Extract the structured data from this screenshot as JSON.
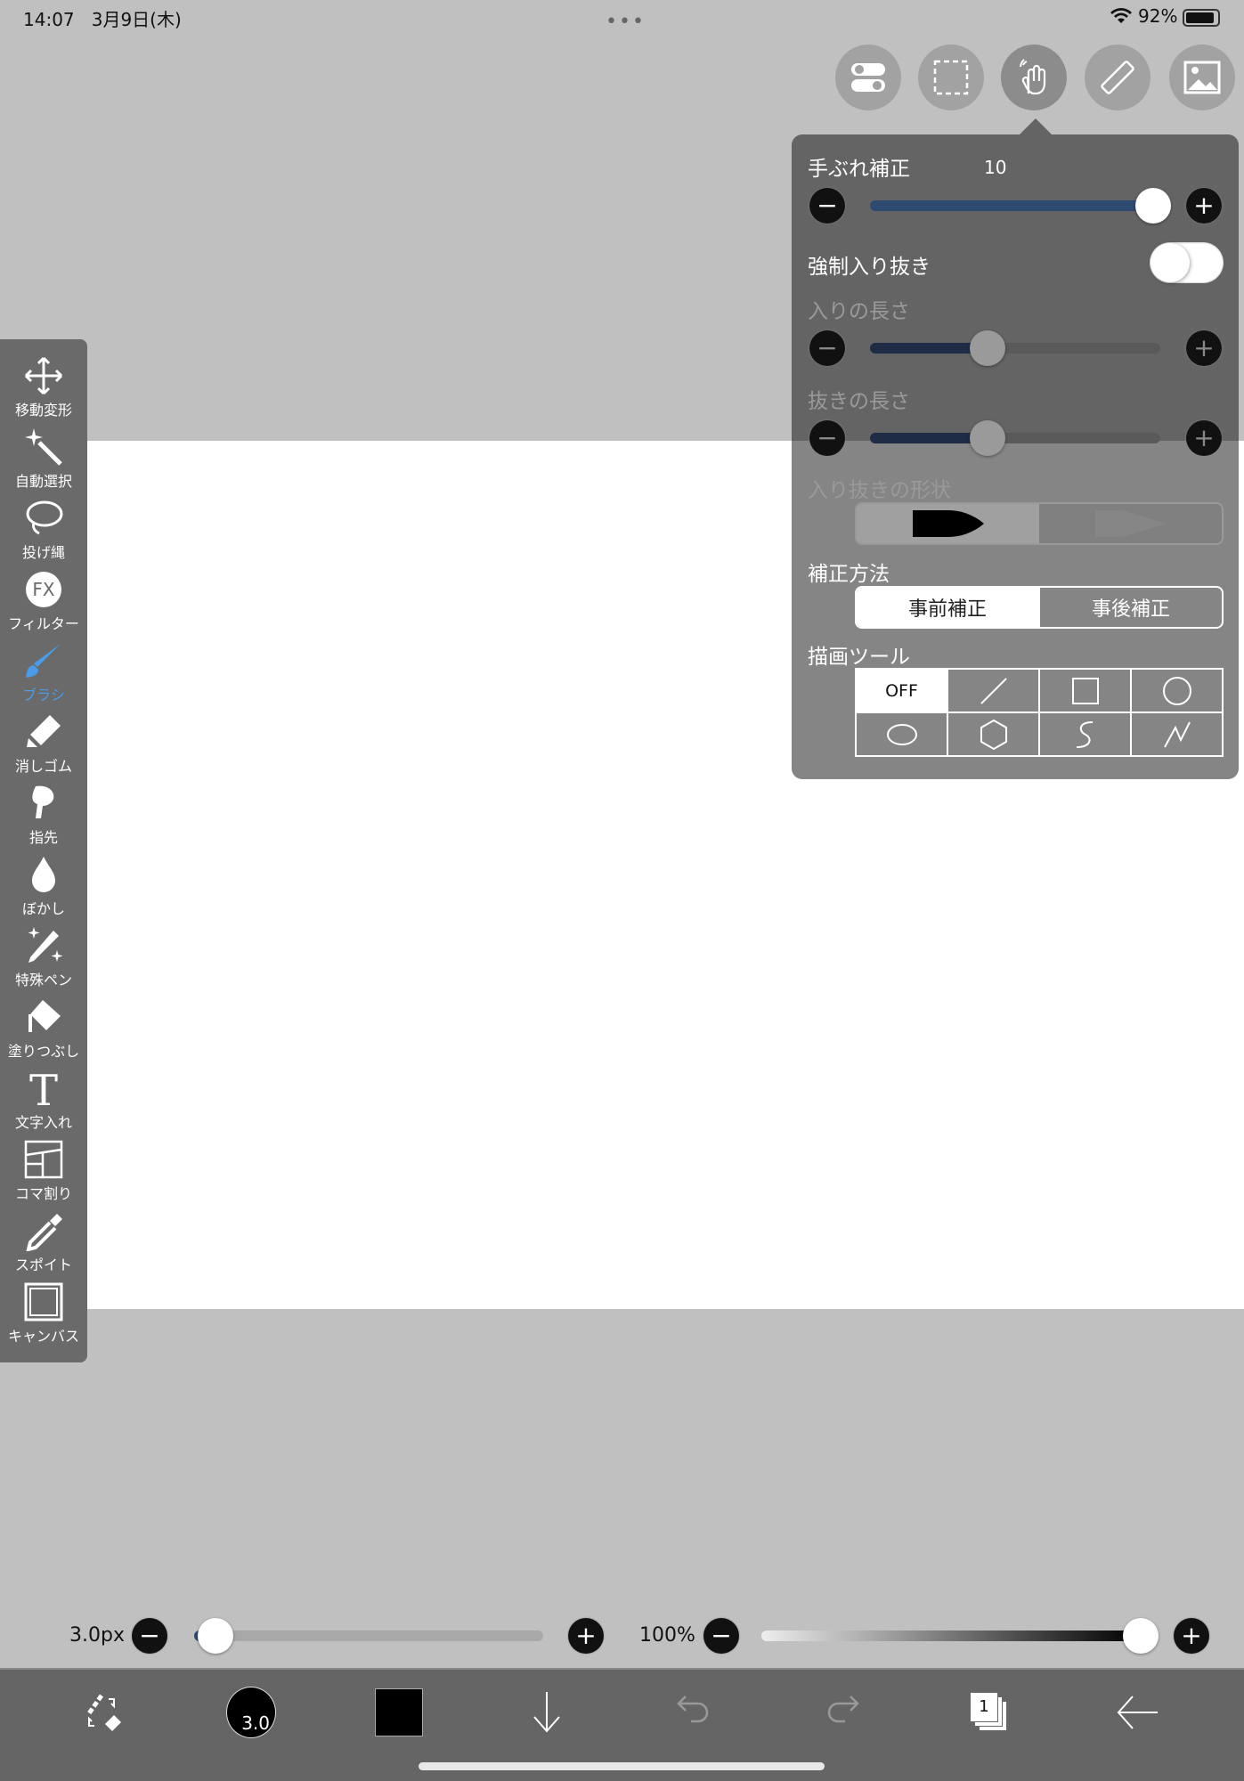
{
  "status": {
    "time": "14:07",
    "date": "3月9日(木)",
    "battery": "92%"
  },
  "top_buttons": [
    "settings-toggle",
    "selection",
    "gesture-hand",
    "ruler",
    "image"
  ],
  "left_toolbar": [
    {
      "label": "移動変形",
      "icon": "move-icon"
    },
    {
      "label": "自動選択",
      "icon": "magic-wand-icon"
    },
    {
      "label": "投げ縄",
      "icon": "lasso-icon"
    },
    {
      "label": "フィルター",
      "icon": "fx-icon"
    },
    {
      "label": "ブラシ",
      "icon": "brush-icon",
      "selected": true
    },
    {
      "label": "消しゴム",
      "icon": "eraser-icon"
    },
    {
      "label": "指先",
      "icon": "finger-icon"
    },
    {
      "label": "ぼかし",
      "icon": "blur-drop-icon"
    },
    {
      "label": "特殊ペン",
      "icon": "special-pen-icon"
    },
    {
      "label": "塗りつぶし",
      "icon": "fill-bucket-icon"
    },
    {
      "label": "文字入れ",
      "icon": "text-icon"
    },
    {
      "label": "コマ割り",
      "icon": "panel-icon"
    },
    {
      "label": "スポイト",
      "icon": "eyedropper-icon"
    },
    {
      "label": "キャンバス",
      "icon": "canvas-icon"
    }
  ],
  "popup": {
    "stabilizer": {
      "label": "手ぶれ補正",
      "value": "10",
      "fraction": 1.0
    },
    "force_taper": {
      "label": "強制入り抜き",
      "on": false
    },
    "taper_in": {
      "label": "入りの長さ",
      "fraction": 0.4
    },
    "taper_out": {
      "label": "抜きの長さ",
      "fraction": 0.4
    },
    "taper_shape": {
      "label": "入り抜きの形状"
    },
    "correction": {
      "label": "補正方法",
      "options": [
        "事前補正",
        "事後補正"
      ],
      "selected": 0
    },
    "draw_tool": {
      "label": "描画ツール",
      "off": "OFF"
    }
  },
  "bottom": {
    "size_label": "3.0px",
    "size_fraction": 0.05,
    "opacity_label": "100%",
    "opacity_fraction": 1.0,
    "brush_size_badge": "3.0",
    "layer_count": "1"
  },
  "colors": {
    "accent": "#4a9be8",
    "slider_fill": "#2f4a70"
  }
}
